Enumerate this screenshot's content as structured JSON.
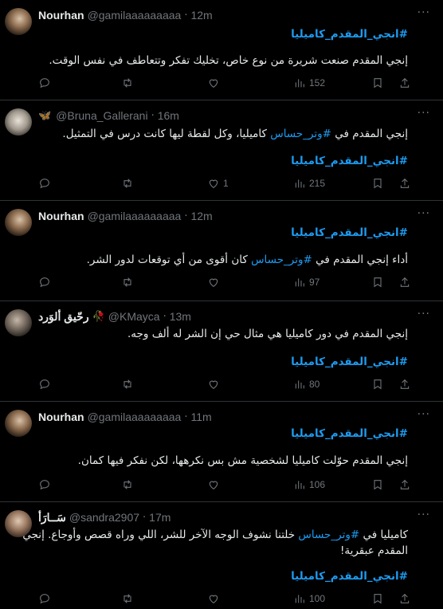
{
  "tweets": [
    {
      "name": "Nourhan",
      "handle": "@gamilaaaaaaaaa",
      "time": "12m",
      "lines": [
        "#انجي_المقدم_كاميليا",
        "إنجي المقدم صنعت شريرة من نوع خاص، تخليك تفكر وتتعاطف في نفس الوقت."
      ],
      "likes": "",
      "views": "152"
    },
    {
      "name": "",
      "emoji": "🦋",
      "handle": "@Bruna_Gallerani",
      "time": "16m",
      "line1_pre": "إنجي المقدم في ",
      "line1_link": "#وتر_حساس",
      "line1_post": " كاميليا، وكل لقطة ليها كانت درس في التمثيل.",
      "hashtag": "#انجي_المقدم_كاميليا",
      "likes": "1",
      "views": "215"
    },
    {
      "name": "Nourhan",
      "handle": "@gamilaaaaaaaaa",
      "time": "12m",
      "hashtag": "#انجي_المقدم_كاميليا",
      "line1_pre": "أداء إنجي المقدم في ",
      "line1_link": "#وتر_حساس",
      "line1_post": " كان أقوى من أي توقعات لدور الشر.",
      "likes": "",
      "views": "97"
    },
    {
      "name": "رحّيق ألوَرد",
      "emoji": "🥀",
      "handle": "@KMayca",
      "time": "13m",
      "line1": "إنجي المقدم في دور كاميليا هي مثال حي إن الشر له ألف وجه.",
      "hashtag": "#انجي_المقدم_كاميليا",
      "likes": "",
      "views": "80"
    },
    {
      "name": "Nourhan",
      "handle": "@gamilaaaaaaaaa",
      "time": "11m",
      "hashtag": "#انجي_المقدم_كاميليا",
      "line1": "إنجي المقدم حوّلت كاميليا لشخصية مش بس نكرهها، لكن نفكر فيها كمان.",
      "likes": "",
      "views": "106"
    },
    {
      "name": "سَــارَأ",
      "handle": "@sandra2907",
      "time": "17m",
      "line1_pre": "كاميليا في ",
      "line1_link": "#وتر_حساس",
      "line1_post": " خلتنا نشوف الوجه الآخر للشر، اللي وراه قصص وأوجاع. إنجي",
      "line2": "المقدم عبقرية!",
      "hashtag": "#انجي_المقدم_كاميليا",
      "likes": "",
      "views": "100"
    }
  ],
  "icons": {
    "reply": "reply-icon",
    "retweet": "retweet-icon",
    "like": "heart-icon",
    "views": "views-icon",
    "bookmark": "bookmark-icon",
    "share": "share-icon",
    "more": "more-icon"
  },
  "colors": {
    "background": "#000000",
    "text": "#e7e9ea",
    "muted": "#71767b",
    "link": "#1d9bf0",
    "divider": "#2f3336"
  }
}
